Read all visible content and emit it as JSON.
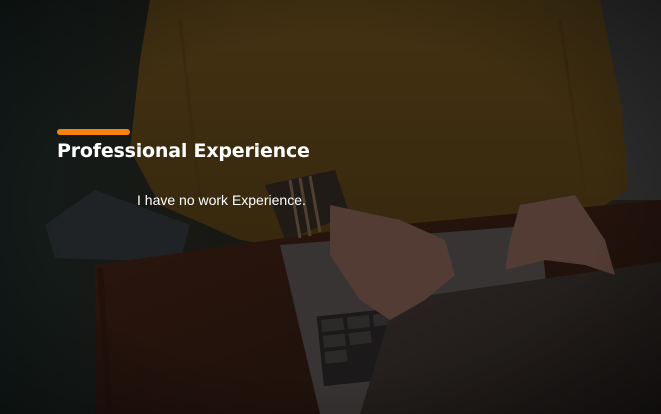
{
  "slide": {
    "title": "Professional Experience",
    "body": "I have no work Experience.",
    "accent_color": "#f5830f",
    "background_image": "person-typing-on-laptop-photo"
  }
}
